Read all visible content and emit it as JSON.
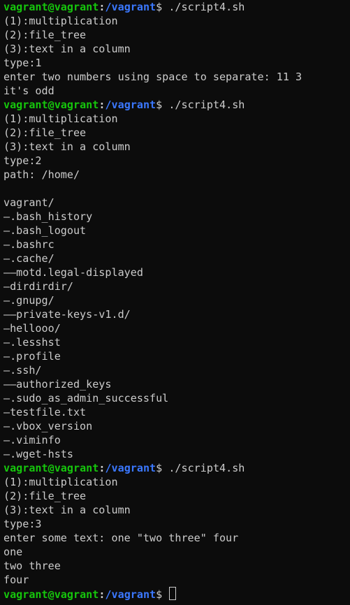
{
  "prompt": {
    "user": "vagrant",
    "at": "@",
    "host": "vagrant",
    "colon": ":",
    "path": "/vagrant",
    "dollar": "$ "
  },
  "colors": {
    "background": "#0c0c0c",
    "text": "#cccccc",
    "prompt_user_host": "#16c60c",
    "prompt_path": "#3b78ff"
  },
  "lines": [
    {
      "type": "prompt",
      "command": "./script4.sh"
    },
    {
      "type": "text",
      "text": "(1):multiplication"
    },
    {
      "type": "text",
      "text": "(2):file_tree"
    },
    {
      "type": "text",
      "text": "(3):text in a column"
    },
    {
      "type": "text",
      "text": "type:1"
    },
    {
      "type": "text",
      "text": "enter two numbers using space to separate: 11 3"
    },
    {
      "type": "text",
      "text": "it's odd"
    },
    {
      "type": "prompt",
      "command": "./script4.sh"
    },
    {
      "type": "text",
      "text": "(1):multiplication"
    },
    {
      "type": "text",
      "text": "(2):file_tree"
    },
    {
      "type": "text",
      "text": "(3):text in a column"
    },
    {
      "type": "text",
      "text": "type:2"
    },
    {
      "type": "text",
      "text": "path: /home/"
    },
    {
      "type": "text",
      "text": ""
    },
    {
      "type": "text",
      "text": "vagrant/"
    },
    {
      "type": "text",
      "text": "—.bash_history"
    },
    {
      "type": "text",
      "text": "—.bash_logout"
    },
    {
      "type": "text",
      "text": "—.bashrc"
    },
    {
      "type": "text",
      "text": "—.cache/"
    },
    {
      "type": "text",
      "text": "——motd.legal-displayed"
    },
    {
      "type": "text",
      "text": "—dirdirdir/"
    },
    {
      "type": "text",
      "text": "—.gnupg/"
    },
    {
      "type": "text",
      "text": "——private-keys-v1.d/"
    },
    {
      "type": "text",
      "text": "—hellooo/"
    },
    {
      "type": "text",
      "text": "—.lesshst"
    },
    {
      "type": "text",
      "text": "—.profile"
    },
    {
      "type": "text",
      "text": "—.ssh/"
    },
    {
      "type": "text",
      "text": "——authorized_keys"
    },
    {
      "type": "text",
      "text": "—.sudo_as_admin_successful"
    },
    {
      "type": "text",
      "text": "—testfile.txt"
    },
    {
      "type": "text",
      "text": "—.vbox_version"
    },
    {
      "type": "text",
      "text": "—.viminfo"
    },
    {
      "type": "text",
      "text": "—.wget-hsts"
    },
    {
      "type": "prompt",
      "command": "./script4.sh"
    },
    {
      "type": "text",
      "text": "(1):multiplication"
    },
    {
      "type": "text",
      "text": "(2):file_tree"
    },
    {
      "type": "text",
      "text": "(3):text in a column"
    },
    {
      "type": "text",
      "text": "type:3"
    },
    {
      "type": "text",
      "text": "enter some text: one \"two three\" four"
    },
    {
      "type": "text",
      "text": "one"
    },
    {
      "type": "text",
      "text": "two three"
    },
    {
      "type": "text",
      "text": "four"
    },
    {
      "type": "prompt",
      "command": "",
      "cursor": true
    }
  ]
}
